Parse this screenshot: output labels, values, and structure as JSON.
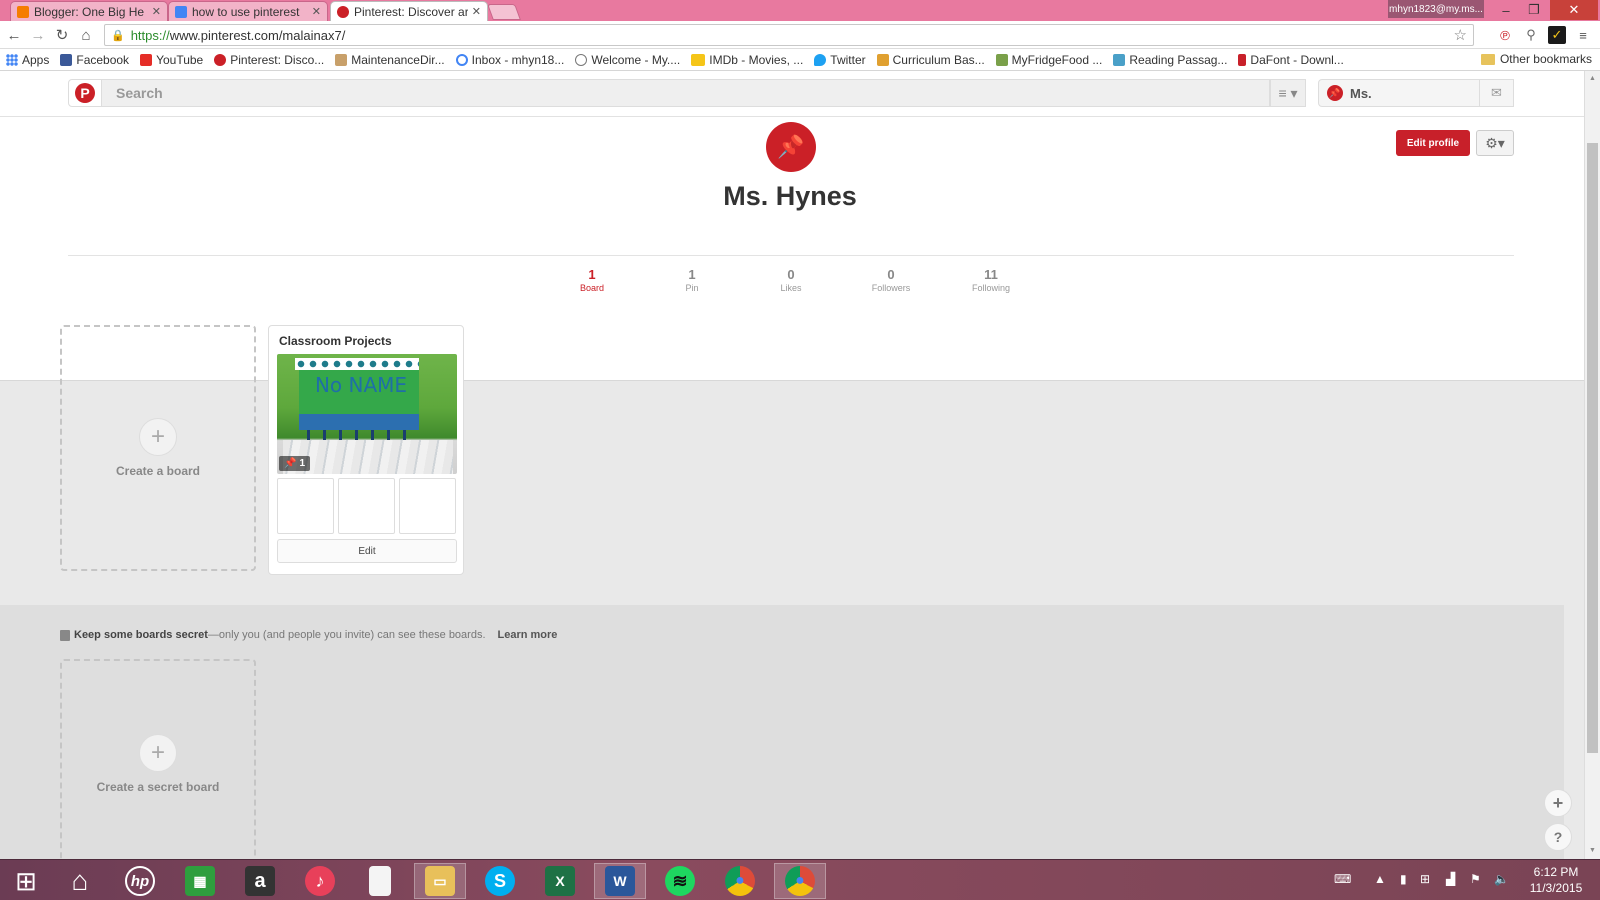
{
  "browser": {
    "tabs": [
      {
        "label": "Blogger: One Big He",
        "favicon_color": "#f57d00"
      },
      {
        "label": "how to use pinterest",
        "favicon_color": "#4285f4"
      },
      {
        "label": "Pinterest: Discover ar",
        "favicon_color": "#cb2027"
      }
    ],
    "profile_chip": "mhyn1823@my.ms...",
    "url_scheme": "https://",
    "url_rest": "www.pinterest.com/malainax7/",
    "bookmarks": [
      {
        "label": "Apps",
        "icon": "apps-grid-icon",
        "color": "#4285f4"
      },
      {
        "label": "Facebook",
        "icon": "facebook-icon",
        "color": "#3b5998"
      },
      {
        "label": "YouTube",
        "icon": "youtube-icon",
        "color": "#e52d27"
      },
      {
        "label": "Pinterest: Disco...",
        "icon": "pinterest-icon",
        "color": "#cb2027"
      },
      {
        "label": "MaintenanceDir...",
        "icon": "wrench-icon",
        "color": "#c8a06a"
      },
      {
        "label": "Inbox - mhyn18...",
        "icon": "google-icon",
        "color": "#4285f4"
      },
      {
        "label": "Welcome - My....",
        "icon": "welcome-icon",
        "color": "#777777"
      },
      {
        "label": "IMDb - Movies, ...",
        "icon": "imdb-icon",
        "color": "#f5c518"
      },
      {
        "label": "Twitter",
        "icon": "twitter-icon",
        "color": "#1da1f2"
      },
      {
        "label": "Curriculum Bas...",
        "icon": "curriculum-icon",
        "color": "#e0a030"
      },
      {
        "label": "MyFridgeFood ...",
        "icon": "fridge-icon",
        "color": "#7aa04a"
      },
      {
        "label": "Reading Passag...",
        "icon": "reading-icon",
        "color": "#4aa0c8"
      },
      {
        "label": "DaFont - Downl...",
        "icon": "dafont-icon",
        "color": "#c8202a"
      }
    ],
    "other_bookmarks": "Other bookmarks"
  },
  "pinterest": {
    "search_placeholder": "Search",
    "user_label": "Ms.",
    "profile_name": "Ms. Hynes",
    "edit_profile": "Edit profile",
    "stats": [
      {
        "num": "1",
        "label": "Board"
      },
      {
        "num": "1",
        "label": "Pin"
      },
      {
        "num": "0",
        "label": "Likes"
      },
      {
        "num": "0",
        "label": "Followers"
      },
      {
        "num": "11",
        "label": "Following"
      }
    ],
    "create_board": "Create a board",
    "board": {
      "title": "Classroom Projects",
      "cover_text": "No NAME",
      "pin_count": "1",
      "edit": "Edit"
    },
    "secret": {
      "bold": "Keep some boards secret",
      "rest": "—only you (and people you invite) can see these boards.",
      "learn_more": "Learn more",
      "create_secret_board": "Create a secret board"
    }
  },
  "taskbar": {
    "time": "6:12 PM",
    "date": "11/3/2015",
    "apps": [
      {
        "name": "start-icon",
        "glyph": "⊞",
        "color": "transparent"
      },
      {
        "name": "home-icon",
        "glyph": "⌂",
        "color": "transparent"
      },
      {
        "name": "hp-icon",
        "glyph": "hp",
        "color": "#ffffff"
      },
      {
        "name": "store-icon",
        "glyph": "▦",
        "color": "#2e9e3e"
      },
      {
        "name": "amazon-icon",
        "glyph": "a",
        "color": "#333333"
      },
      {
        "name": "itunes-icon",
        "glyph": "♪",
        "color": "#e8405a"
      },
      {
        "name": "document-icon",
        "glyph": "",
        "color": "#f4f4f4"
      },
      {
        "name": "file-explorer-icon",
        "glyph": "▭",
        "color": "#e8c05a"
      },
      {
        "name": "skype-icon",
        "glyph": "S",
        "color": "#00aff0"
      },
      {
        "name": "excel-icon",
        "glyph": "X",
        "color": "#1e7145"
      },
      {
        "name": "word-icon",
        "glyph": "W",
        "color": "#2b579a"
      },
      {
        "name": "spotify-icon",
        "glyph": "≋",
        "color": "#1ed760"
      },
      {
        "name": "chrome-icon",
        "glyph": "◉",
        "color": "#dd4b39"
      },
      {
        "name": "chrome-active-icon",
        "glyph": "◉",
        "color": "#dd4b39"
      }
    ]
  }
}
